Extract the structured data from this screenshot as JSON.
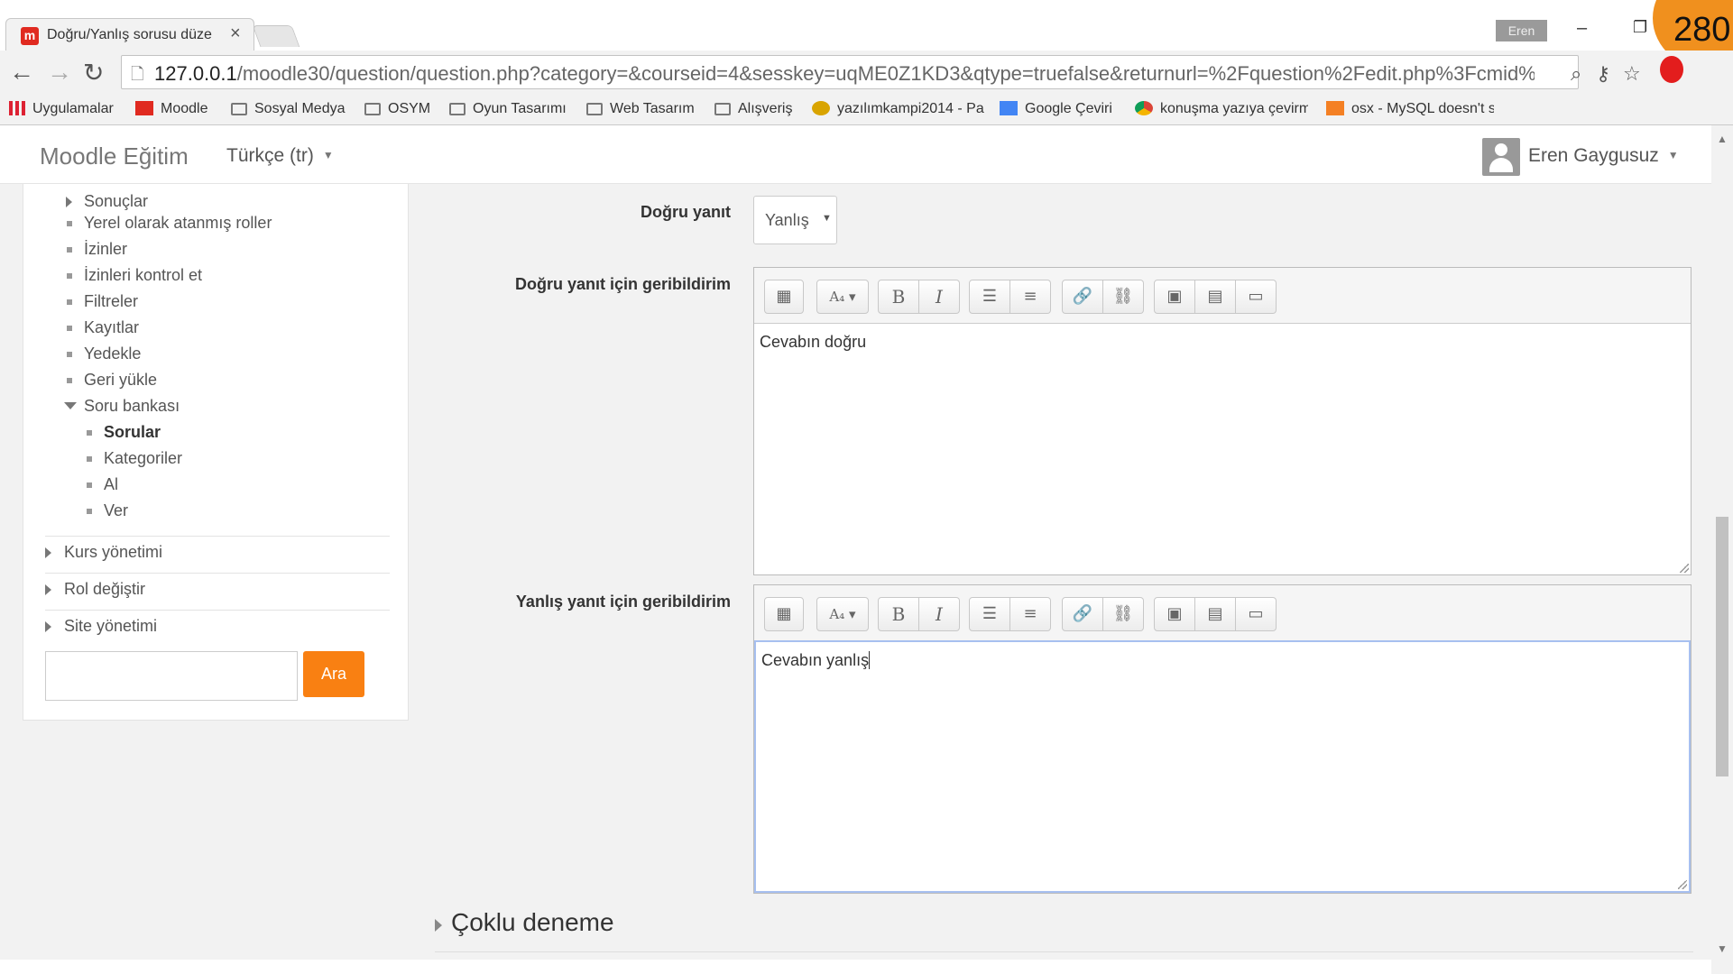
{
  "browser": {
    "tab_title": "Doğru/Yanlış sorusu düze",
    "tab_favicon": "m",
    "profile": "Eren",
    "recording_number": "280",
    "url_host": "127.0.0.1",
    "url_path": "/moodle30/question/question.php?category=&courseid=4&sesskey=uqME0Z1KD3&qtype=truefalse&returnurl=%2Fquestion%2Fedit.php%3Fcmid%",
    "bookmarks": [
      "Uygulamalar",
      "Moodle",
      "Sosyal Medya",
      "OSYM",
      "Oyun Tasarımı",
      "Web Tasarım",
      "Alışveriş",
      "yazılımkampi2014 - Pa",
      "Google Çeviri",
      "konuşma yazıya çevirme",
      "osx - MySQL doesn't s"
    ]
  },
  "navbar": {
    "brand": "Moodle Eğitim",
    "language": "Türkçe (tr)",
    "user_name": "Eren Gaygusuz"
  },
  "sidebar": {
    "items": [
      "Sonuçlar",
      "Yerel olarak atanmış roller",
      "İzinler",
      "İzinleri kontrol et",
      "Filtreler",
      "Kayıtlar",
      "Yedekle",
      "Geri yükle",
      "Soru bankası"
    ],
    "sub_items": [
      "Sorular",
      "Kategoriler",
      "Al",
      "Ver"
    ],
    "sections": [
      "Kurs yönetimi",
      "Rol değiştir",
      "Site yönetimi"
    ],
    "search_button": "Ara"
  },
  "form": {
    "correct_answer_label": "Doğru yanıt",
    "correct_answer_value": "Yanlış",
    "true_feedback_label": "Doğru yanıt için geribildirim",
    "true_feedback_text": "Cevabın doğru",
    "false_feedback_label": "Yanlış yanıt için geribildirim",
    "false_feedback_text": "Cevabın yanlış",
    "next_section": "Çoklu deneme"
  }
}
